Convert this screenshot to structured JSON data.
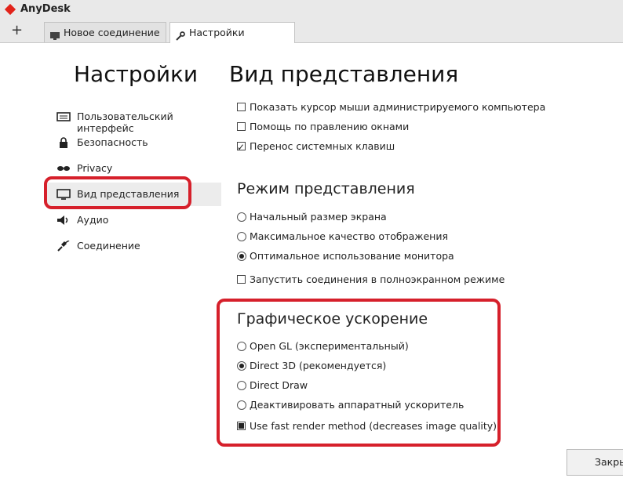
{
  "window": {
    "app_title": "AnyDesk",
    "logo_icon": "anydesk-diamond-icon"
  },
  "tabs": [
    {
      "label": "Новое соединение",
      "icon": "monitor-icon"
    },
    {
      "label": "Настройки",
      "icon": "wrench-icon"
    }
  ],
  "tabbar": {
    "new_tab": "+"
  },
  "page": {
    "title": "Настройки",
    "section_title": "Вид представления"
  },
  "sidebar": {
    "items": [
      {
        "label": "Пользовательский интерфейс",
        "icon": "keyboard-icon"
      },
      {
        "label": "Безопасность",
        "icon": "lock-icon"
      },
      {
        "label": "Privacy",
        "icon": "glasses-icon"
      },
      {
        "label": "Вид представления",
        "icon": "monitor-icon",
        "selected": true
      },
      {
        "label": "Аудио",
        "icon": "speaker-icon"
      },
      {
        "label": "Соединение",
        "icon": "plug-icon"
      }
    ]
  },
  "general_options": [
    {
      "label": "Показать курсор мыши администрируемого компьютера",
      "checked": false
    },
    {
      "label": "Помощь по правлению окнами",
      "checked": false
    },
    {
      "label": "Перенос системных клавиш",
      "checked": true
    }
  ],
  "display_mode": {
    "title": "Режим представления",
    "options": [
      {
        "label": "Начальный размер экрана",
        "selected": false
      },
      {
        "label": "Максимальное качество отображения",
        "selected": false
      },
      {
        "label": "Оптимальное использование монитора",
        "selected": true
      }
    ],
    "fullscreen_label": "Запустить соединения в полноэкранном режиме",
    "fullscreen_checked": false
  },
  "graphics": {
    "title": "Графическое ускорение",
    "options": [
      {
        "label": "Open GL (экспериментальный)",
        "selected": false
      },
      {
        "label": "Direct 3D (рекомендуется)",
        "selected": true
      },
      {
        "label": "Direct Draw",
        "selected": false
      },
      {
        "label": "Деактивировать аппаратный ускоритель",
        "selected": false
      }
    ],
    "fast_render_label": "Use fast render method (decreases image quality).",
    "fast_render_checked": true
  },
  "footer": {
    "close_label": "Закрыть"
  },
  "colors": {
    "highlight": "#d6202b",
    "brand": "#e2231a"
  }
}
